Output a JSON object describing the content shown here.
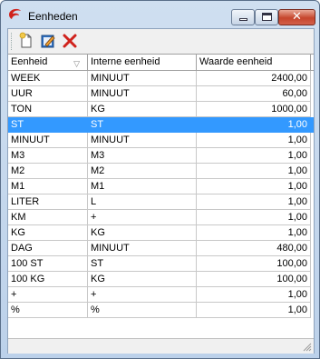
{
  "window": {
    "title": "Eenheden"
  },
  "toolbar": {
    "buttons": [
      {
        "icon": "new-document-icon"
      },
      {
        "icon": "edit-icon"
      },
      {
        "icon": "delete-icon"
      }
    ]
  },
  "grid": {
    "columns": [
      "Eenheid",
      "Interne eenheid",
      "Waarde eenheid"
    ],
    "rows": [
      {
        "eenheid": "WEEK",
        "interne": "MINUUT",
        "waarde": "2400,00",
        "selected": false
      },
      {
        "eenheid": "UUR",
        "interne": "MINUUT",
        "waarde": "60,00",
        "selected": false
      },
      {
        "eenheid": "TON",
        "interne": "KG",
        "waarde": "1000,00",
        "selected": false
      },
      {
        "eenheid": "ST",
        "interne": "ST",
        "waarde": "1,00",
        "selected": true
      },
      {
        "eenheid": "MINUUT",
        "interne": "MINUUT",
        "waarde": "1,00",
        "selected": false
      },
      {
        "eenheid": "M3",
        "interne": "M3",
        "waarde": "1,00",
        "selected": false
      },
      {
        "eenheid": "M2",
        "interne": "M2",
        "waarde": "1,00",
        "selected": false
      },
      {
        "eenheid": "M1",
        "interne": "M1",
        "waarde": "1,00",
        "selected": false
      },
      {
        "eenheid": "LITER",
        "interne": "L",
        "waarde": "1,00",
        "selected": false
      },
      {
        "eenheid": "KM",
        "interne": "+",
        "waarde": "1,00",
        "selected": false
      },
      {
        "eenheid": "KG",
        "interne": "KG",
        "waarde": "1,00",
        "selected": false
      },
      {
        "eenheid": "DAG",
        "interne": "MINUUT",
        "waarde": "480,00",
        "selected": false
      },
      {
        "eenheid": "100 ST",
        "interne": "ST",
        "waarde": "100,00",
        "selected": false
      },
      {
        "eenheid": "100 KG",
        "interne": "KG",
        "waarde": "100,00",
        "selected": false
      },
      {
        "eenheid": "+",
        "interne": "+",
        "waarde": "1,00",
        "selected": false
      },
      {
        "eenheid": "%",
        "interne": "%",
        "waarde": "1,00",
        "selected": false
      }
    ]
  },
  "colors": {
    "selection": "#3399ff",
    "close_button": "#c6452c"
  }
}
